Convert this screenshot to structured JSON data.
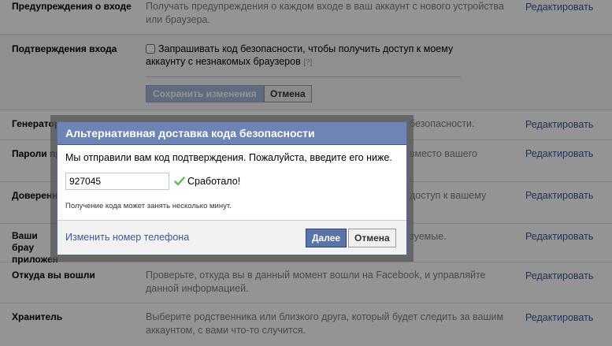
{
  "rows": [
    {
      "label": "Предупреждения о входе",
      "desc": "Получать предупреждения о каждом входе в ваш аккаунт с нового устройства или браузера.",
      "edit": "Редактировать"
    },
    {
      "label": "Подтверждения входа"
    },
    {
      "label": "Генератор",
      "desc": "безопасности.",
      "edit": "Редактировать"
    },
    {
      "label": "Пароли пр",
      "desc": "вместо вашего",
      "edit": "Редактировать"
    },
    {
      "label": "Доверенн",
      "desc": "доступ к вашему",
      "edit": "Редактировать"
    },
    {
      "label": "Ваши брау приложен",
      "desc": "зуемые.",
      "edit": "Редактировать"
    },
    {
      "label": "Откуда вы вошли",
      "desc": "Проверьте, откуда вы в данный момент вошли на Facebook, и управляйте данной информацией.",
      "edit": "Редактировать"
    },
    {
      "label": "Хранитель",
      "desc": "Выберите родственника или близкого друга, который будет следить за вашим аккаунтом, с вами что-то случится.",
      "edit": "Редактировать"
    }
  ],
  "login_approvals": {
    "checkbox_label": "Запрашивать код безопасности, чтобы получить доступ к моему аккаунту с незнакомых браузеров",
    "help": "[?]",
    "save_label": "Сохранить изменения",
    "cancel_label": "Отмена"
  },
  "dialog": {
    "title": "Альтернативная доставка кода безопасности",
    "message": "Мы отправили вам код подтверждения. Пожалуйста, введите его ниже.",
    "code_value": "927045",
    "success_text": "Сработало!",
    "note": "Получение кода может занять несколько минут.",
    "change_phone_link": "Изменить номер телефона",
    "confirm_label": "Далее",
    "cancel_label": "Отмена"
  },
  "colors": {
    "brand_blue": "#3b5998",
    "dialog_header": "#6d84b4",
    "success_check": "#5cb85c"
  }
}
